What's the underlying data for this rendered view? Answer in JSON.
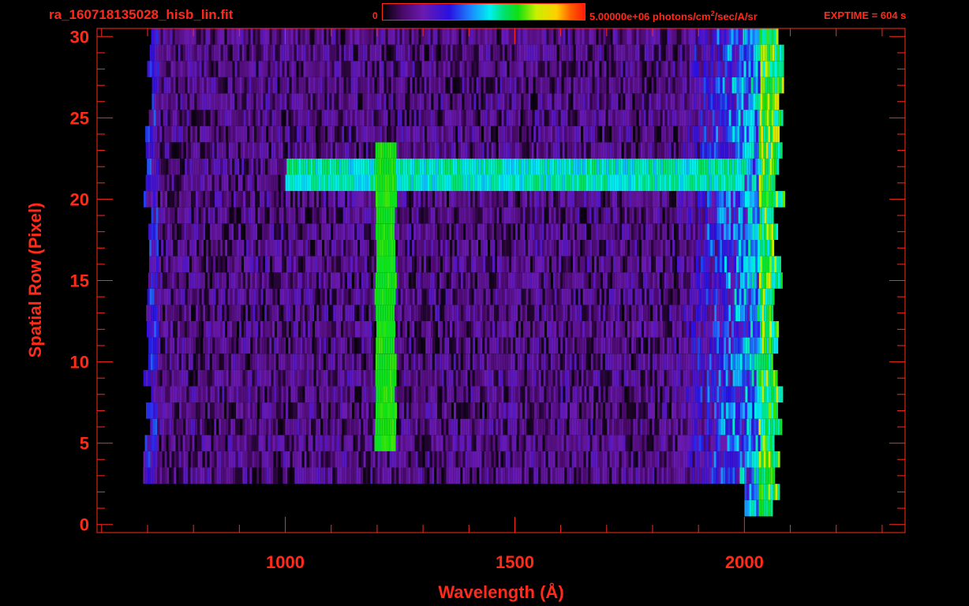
{
  "header": {
    "filename": "ra_160718135028_hisb_lin.fit",
    "colorbar_min": "0",
    "colorbar_max_label_base": "5.00000e+06 photons/cm",
    "colorbar_max_label_exp": "2",
    "colorbar_max_label_tail": "/sec/A/sr",
    "exptime": "EXPTIME = 604 s"
  },
  "colors": {
    "axis": "#ff2a1a",
    "background": "#000000",
    "colormap": [
      "#000000",
      "#4a0a6a",
      "#6a1ab0",
      "#2a10e0",
      "#1a8cff",
      "#00f0f0",
      "#00e070",
      "#10e010",
      "#c8f000",
      "#ffd000",
      "#ff6000",
      "#ff1a0a"
    ]
  },
  "chart_data": {
    "type": "heatmap",
    "title": "ra_160718135028_hisb_lin.fit",
    "xlabel": "Wavelength (Å)",
    "ylabel": "Spatial Row (Pixel)",
    "xlim": [
      590,
      2350
    ],
    "ylim": [
      -0.5,
      30.5
    ],
    "xticks": [
      1000,
      1500,
      2000
    ],
    "xtick_labels": [
      "1000",
      "1500",
      "2000"
    ],
    "yticks": [
      0,
      5,
      10,
      15,
      20,
      25,
      30
    ],
    "ytick_labels": [
      "0",
      "5",
      "10",
      "15",
      "20",
      "25",
      "30"
    ],
    "zlim": [
      0,
      5000000
    ],
    "zunit": "photons/cm^2/sec/A/sr",
    "colorbar": "rainbow, top",
    "features": [
      {
        "name": "bright emission line",
        "wavelength": 1216,
        "rows": [
          5,
          24
        ],
        "level": 0.65
      },
      {
        "name": "horizontal band",
        "wavelength_range": [
          1000,
          2000
        ],
        "rows": [
          21,
          23
        ],
        "level": 0.5
      },
      {
        "name": "long-wavelength edge",
        "wavelength_range": [
          1900,
          2075
        ],
        "rows": [
          1,
          30
        ],
        "level": 0.6
      }
    ]
  }
}
